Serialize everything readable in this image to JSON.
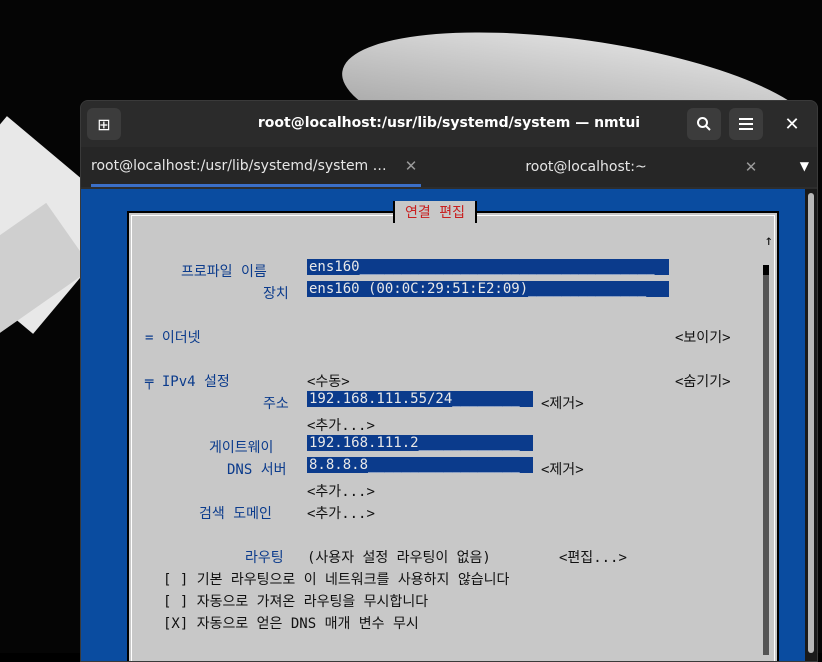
{
  "window": {
    "title": "root@localhost:/usr/lib/systemd/system — nmtui",
    "new_tab_icon": "new-tab-icon",
    "search_icon": "search-icon",
    "menu_icon": "menu-icon",
    "close_icon": "close-icon"
  },
  "tabs": [
    {
      "label": "root@localhost:/usr/lib/systemd/system …",
      "active": true
    },
    {
      "label": "root@localhost:~",
      "active": false
    }
  ],
  "dialog": {
    "title": "연결 편집",
    "profile_name_label": "프로파일 이름",
    "profile_name_value": "ens160___________________________________",
    "device_label": "장치",
    "device_value": "ens160 (00:0C:29:51:E2:09)______________",
    "ethernet_label": "= 이더넷",
    "ethernet_toggle": "<보이기>",
    "ipv4_label": "╤ IPv4 설정",
    "ipv4_mode": "<수동>",
    "ipv4_toggle": "<숨기기>",
    "address_label": "주소",
    "address_value": "192.168.111.55/24________",
    "remove_label": "<제거>",
    "add_label": "<추가...>",
    "gateway_label": "게이트웨이",
    "gateway_value": "192.168.111.2____________",
    "dns_label": "DNS 서버",
    "dns_value": "8.8.8.8__________________",
    "search_domain_label": "검색 도메인",
    "routing_label": "라우팅",
    "routing_value": "(사용자 설정 라우팅이 없음)",
    "edit_label": "<편집...>",
    "check1": "[ ] 기본 라우팅으로 이 네트워크를 사용하지 않습니다",
    "check2": "[ ] 자동으로 가져온 라우팅을 무시합니다",
    "check3": "[X] 자동으로 얻은 DNS 매개 변수 무시"
  }
}
